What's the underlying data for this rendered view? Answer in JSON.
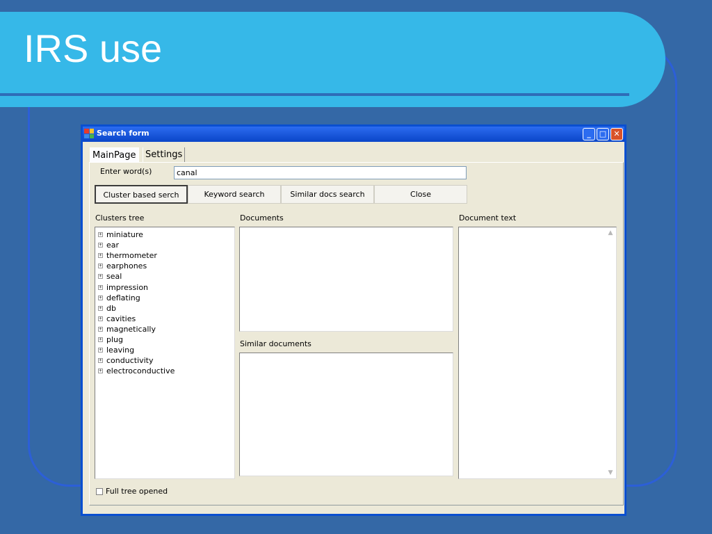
{
  "slide": {
    "title": "IRS use"
  },
  "window": {
    "title": "Search form",
    "min_glyph": "_",
    "max_glyph": "□",
    "close_glyph": "✕"
  },
  "tabs": [
    {
      "label": "MainPage",
      "selected": true
    },
    {
      "label": "Settings",
      "selected": false
    }
  ],
  "search": {
    "label": "Enter word(s)",
    "value": "canal"
  },
  "buttons": {
    "cluster": "Cluster based serch",
    "keyword": "Keyword search",
    "similar": "Similar docs search",
    "close": "Close"
  },
  "clusters": {
    "label": "Clusters tree",
    "items": [
      "miniature",
      "ear",
      "thermometer",
      "earphones",
      "seal",
      "impression",
      "deflating",
      "db",
      "cavities",
      "magnetically",
      "plug",
      "leaving",
      "conductivity",
      "electroconductive"
    ]
  },
  "documents": {
    "label": "Documents"
  },
  "similar_documents": {
    "label": "Similar documents"
  },
  "document_text": {
    "label": "Document text"
  },
  "full_tree": {
    "label": "Full tree opened",
    "checked": false
  },
  "colors": {
    "slide_bg": "#3468a6",
    "title_band": "#36b8e8",
    "window_frame": "#0a4fd0",
    "form_bg": "#ece9d8"
  }
}
